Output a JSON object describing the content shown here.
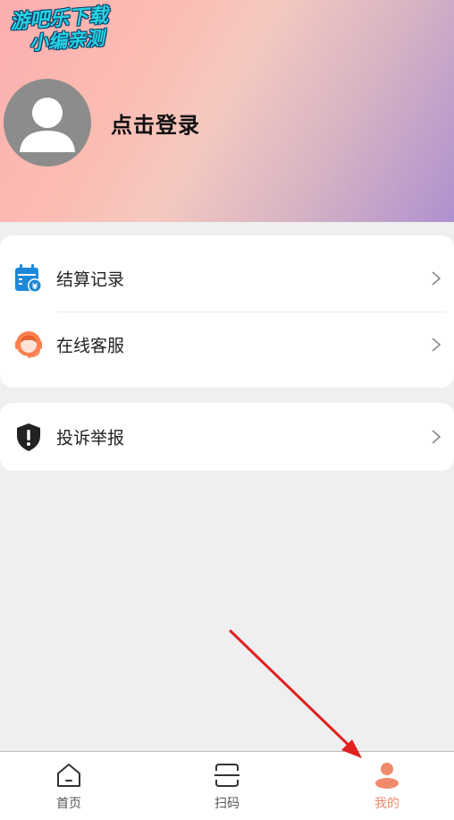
{
  "watermark": {
    "line1": "游吧乐下载",
    "line2": "小编亲测"
  },
  "profile": {
    "login_text": "点击登录"
  },
  "menu": [
    {
      "label": "结算记录",
      "icon": "calendar-yuan-icon"
    },
    {
      "label": "在线客服",
      "icon": "headset-agent-icon"
    },
    {
      "label": "投诉举报",
      "icon": "shield-alert-icon"
    }
  ],
  "tabbar": {
    "tabs": [
      {
        "label": "首页",
        "icon": "home-icon",
        "active": false
      },
      {
        "label": "扫码",
        "icon": "scan-icon",
        "active": false
      },
      {
        "label": "我的",
        "icon": "user-icon",
        "active": true
      }
    ]
  },
  "colors": {
    "accent": "#f08a6a",
    "calendar_blue": "#1e88d8",
    "headset_orange": "#ff7f4f"
  }
}
